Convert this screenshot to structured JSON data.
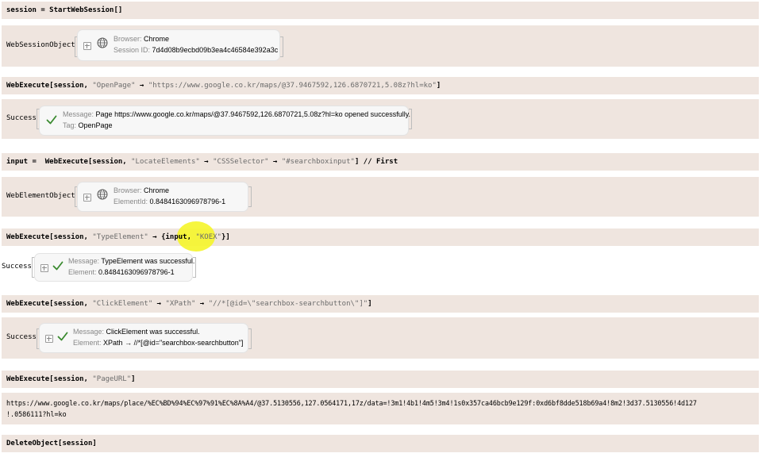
{
  "cells": {
    "c1": {
      "lhs": "session = StartWebSession[]"
    },
    "c2": {
      "head": "WebSessionObject",
      "browser_key": "Browser:",
      "browser_val": "Chrome",
      "session_key": "Session ID:",
      "session_val": "7d4d08b9ecbd09b3ea4c46584e392a3c"
    },
    "c3": {
      "pre": "WebExecute[session, ",
      "s1": "\"OpenPage\"",
      "arrow": " → ",
      "s2": "\"https://www.google.co.kr/maps/@37.9467592,126.6870721,5.08z?hl=ko\"",
      "post": "]"
    },
    "c4": {
      "head": "Success",
      "msg_key": "Message:",
      "msg_val": "Page https://www.google.co.kr/maps/@37.9467592,126.6870721,5.08z?hl=ko opened successfully.",
      "tag_key": "Tag:",
      "tag_val": "OpenPage"
    },
    "c5": {
      "pre": "input =  WebExecute[session, ",
      "s1": "\"LocateElements\"",
      "arrow1": " → ",
      "s2": "\"CSSSelector\"",
      "arrow2": " → ",
      "s3": "\"#searchboxinput\"",
      "post": "] // First"
    },
    "c6": {
      "head": "WebElementObject",
      "browser_key": "Browser:",
      "browser_val": "Chrome",
      "el_key": "ElementId:",
      "el_val": "0.8484163096978796-1"
    },
    "c7": {
      "pre": "WebExecute[session, ",
      "s1": "\"TypeElement\"",
      "mid": " → {input, ",
      "s2": "\"KOEX\"",
      "post": "}]"
    },
    "c8": {
      "head": "Success",
      "msg_key": "Message:",
      "msg_val": "TypeElement was successful.",
      "el_key": "Element:",
      "el_val": "0.8484163096978796-1"
    },
    "c9": {
      "pre": "WebExecute[session, ",
      "s1": "\"ClickElement\"",
      "arrow1": " → ",
      "s2": "\"XPath\"",
      "arrow2": " → ",
      "s3": "\"//*[@id=\\\"searchbox-searchbutton\\\"]\"",
      "post": "]"
    },
    "c10": {
      "head": "Success",
      "msg_key": "Message:",
      "msg_val": "ClickElement was successful.",
      "el_key": "Element:",
      "el_val": "XPath → //*[@id=\"searchbox-searchbutton\"]"
    },
    "c11": {
      "pre": "WebExecute[session, ",
      "s1": "\"PageURL\"",
      "post": "]"
    },
    "c12": {
      "line1": "https://www.google.co.kr/maps/place/%EC%BD%94%EC%97%91%EC%8A%A4/@37.5130556,127.0564171,17z/data=!3m1!4b1!4m5!3m4!1s0x357ca46bcb9e129f:0xd6bf8dde518b69a4!8m2!3d37.5130556!4d127",
      "line2": "!.0586111?hl=ko"
    },
    "c13": {
      "lhs": "DeleteObject[session]"
    }
  },
  "colors": {
    "cell_bg": "#efe5df",
    "highlight": "#f5f52a",
    "check": "#3a8a2f",
    "string": "#6b6b6b"
  }
}
